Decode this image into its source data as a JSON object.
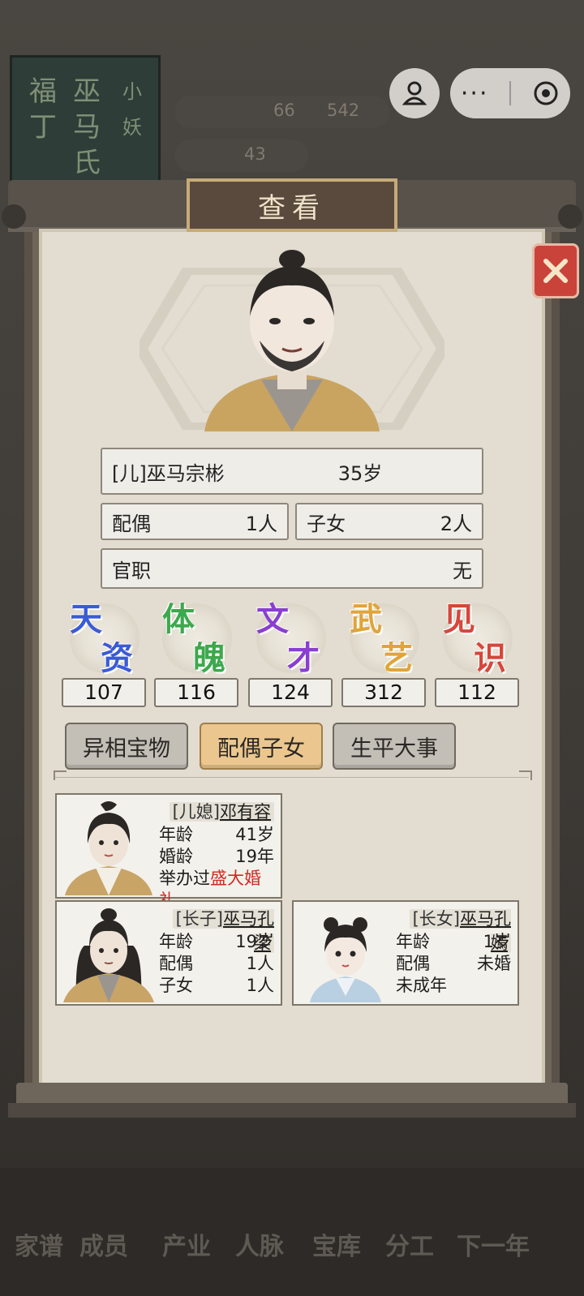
{
  "background": {
    "book_columns": [
      "福丁",
      "巫马氏",
      "小妖"
    ],
    "resources": {
      "copper": "66",
      "silver": "542",
      "food": "43"
    },
    "nav": [
      "家谱",
      "成员",
      "产业",
      "人脉",
      "宝库",
      "分工",
      "下一年"
    ]
  },
  "dialog": {
    "title": "查看",
    "person": {
      "relation_name": "[儿]巫马宗彬",
      "age": "35岁",
      "spouse_label": "配偶",
      "spouse_value": "1人",
      "children_label": "子女",
      "children_value": "2人",
      "office_label": "官职",
      "office_value": "无"
    },
    "attributes": [
      {
        "c1": "天",
        "c2": "资",
        "value": "107",
        "color": "#3b5bd6"
      },
      {
        "c1": "体",
        "c2": "魄",
        "value": "116",
        "color": "#3da84d"
      },
      {
        "c1": "文",
        "c2": "才",
        "value": "124",
        "color": "#8a3fd0"
      },
      {
        "c1": "武",
        "c2": "艺",
        "value": "312",
        "color": "#e0a43a"
      },
      {
        "c1": "见",
        "c2": "识",
        "value": "112",
        "color": "#d6463c"
      }
    ],
    "tabs": [
      "异相宝物",
      "配偶子女",
      "生平大事"
    ],
    "members": {
      "wife": {
        "prefix": "[儿媳]",
        "name": "邓有容",
        "age_label": "年龄",
        "age": "41岁",
        "marriage_label": "婚龄",
        "marriage": "19年",
        "note_prefix": "举办过",
        "note_highlight": "盛大婚礼"
      },
      "son": {
        "prefix": "[长子]",
        "name": "巫马孔梁",
        "age_label": "年龄",
        "age": "19岁",
        "spouse_label": "配偶",
        "spouse": "1人",
        "children_label": "子女",
        "children": "1人"
      },
      "daughter": {
        "prefix": "[长女]",
        "name": "巫马孔嫣",
        "age_label": "年龄",
        "age": "1岁",
        "spouse_label": "配偶",
        "spouse": "未婚",
        "note": "未成年"
      }
    }
  },
  "colors": {
    "highlight": "#d02a22",
    "active_tab": "#ebc78f",
    "close": "#c9433b"
  }
}
